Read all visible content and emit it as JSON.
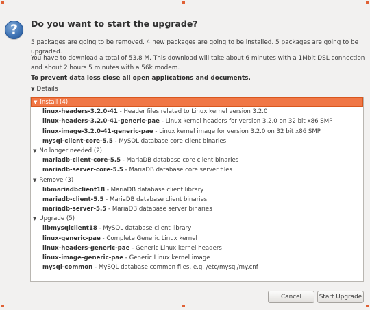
{
  "dialog": {
    "icon": "question-icon",
    "title": "Do you want to start the upgrade?",
    "summary": "5 packages are going to be removed. 4 new packages are going to be installed. 5 packages are going to be upgraded.",
    "download": "You have to download a total of 53.8 M. This download will take about 6 minutes with a 1Mbit DSL connection and about 2 hours 5 minutes with a 56k modem.",
    "warning": "To prevent data loss close all open applications and documents.",
    "details_label": "Details",
    "accent_color": "#f07746"
  },
  "groups": [
    {
      "label": "Install (4)",
      "packages": [
        {
          "name": "linux-headers-3.2.0-41",
          "desc": " - Header files related to Linux kernel version 3.2.0"
        },
        {
          "name": "linux-headers-3.2.0-41-generic-pae",
          "desc": " - Linux kernel headers for version 3.2.0 on 32 bit x86 SMP"
        },
        {
          "name": "linux-image-3.2.0-41-generic-pae",
          "desc": " - Linux kernel image for version 3.2.0 on 32 bit x86 SMP"
        },
        {
          "name": "mysql-client-core-5.5",
          "desc": " - MySQL database core client binaries"
        }
      ]
    },
    {
      "label": "No longer needed (2)",
      "packages": [
        {
          "name": "mariadb-client-core-5.5",
          "desc": " - MariaDB database core client binaries"
        },
        {
          "name": "mariadb-server-core-5.5",
          "desc": " - MariaDB database core server files"
        }
      ]
    },
    {
      "label": "Remove (3)",
      "packages": [
        {
          "name": "libmariadbclient18",
          "desc": " - MariaDB database client library"
        },
        {
          "name": "mariadb-client-5.5",
          "desc": " - MariaDB database client binaries"
        },
        {
          "name": "mariadb-server-5.5",
          "desc": " - MariaDB database server binaries"
        }
      ]
    },
    {
      "label": "Upgrade (5)",
      "packages": [
        {
          "name": "libmysqlclient18",
          "desc": " - MySQL database client library"
        },
        {
          "name": "linux-generic-pae",
          "desc": " - Complete Generic Linux kernel"
        },
        {
          "name": "linux-headers-generic-pae",
          "desc": " - Generic Linux kernel headers"
        },
        {
          "name": "linux-image-generic-pae",
          "desc": " - Generic Linux kernel image"
        },
        {
          "name": "mysql-common",
          "desc": " - MySQL database common files, e.g. /etc/mysql/my.cnf"
        }
      ]
    }
  ],
  "buttons": {
    "cancel": "Cancel",
    "start": "Start Upgrade"
  }
}
